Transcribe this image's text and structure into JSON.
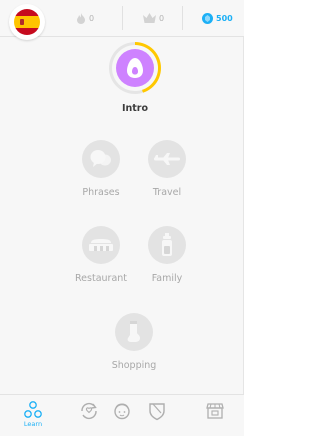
{
  "language_flag": {
    "icon": "spain-flag-icon"
  },
  "stats": {
    "streak": {
      "icon": "fire-icon",
      "value": "0"
    },
    "crowns": {
      "icon": "crown-icon",
      "value": "0"
    },
    "gems": {
      "icon": "gem-icon",
      "value": "500",
      "color": "#1cb0f6"
    }
  },
  "skills": [
    {
      "label": "Intro",
      "icon": "egg-icon",
      "active": true,
      "progress_fraction": 0.45,
      "color": "#ce82ff",
      "ring_color": "#ffc800"
    },
    {
      "label": "Phrases",
      "icon": "speech-bubbles-icon",
      "active": false
    },
    {
      "label": "Travel",
      "icon": "airplane-icon",
      "active": false
    },
    {
      "label": "Restaurant",
      "icon": "restaurant-icon",
      "active": false
    },
    {
      "label": "Family",
      "icon": "baby-bottle-icon",
      "active": false
    },
    {
      "label": "Shopping",
      "icon": "sock-icon",
      "active": false
    }
  ],
  "bottom_nav": [
    {
      "label": "Learn",
      "icon": "learn-icon",
      "active": true
    },
    {
      "label": "",
      "icon": "practice-icon",
      "active": false
    },
    {
      "label": "",
      "icon": "profile-icon",
      "active": false
    },
    {
      "label": "",
      "icon": "shield-icon",
      "active": false
    },
    {
      "label": "",
      "icon": "shop-icon",
      "active": false
    }
  ],
  "colors": {
    "inactive": "#e3e3e3",
    "accent": "#1cb0f6",
    "nav_inactive": "#afafaf"
  }
}
